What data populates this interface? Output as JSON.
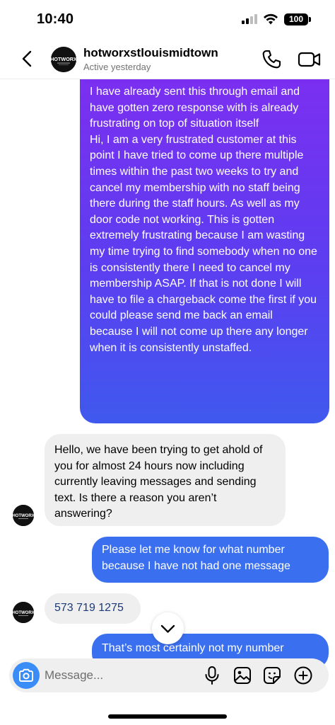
{
  "status_bar": {
    "time": "10:40",
    "battery": "100"
  },
  "header": {
    "name": "hotworxstlouismidtown",
    "status": "Active yesterday",
    "back_icon": "chevron-left-icon",
    "call_icon": "phone-icon",
    "video_icon": "video-camera-icon"
  },
  "avatar": {
    "logo_text": "HOTWORX"
  },
  "messages": [
    {
      "sender": "me",
      "text_1": "I have already sent this through email and have gotten zero response with is already frustrating on top of situation itself",
      "text_2": "Hi, I am a very frustrated customer at this point I have tried to come up there multiple times within the past two weeks to try and cancel my membership with no staff being there during the staff hours. As well as my door code not working. This is gotten extremely frustrating because I am wasting my time trying to find somebody when no one is consistently there I need to cancel my membership ASAP. If that is not done I will have to file a chargeback come the first if you could please send me back an email because I will not come up there any longer when it is consistently unstaffed."
    },
    {
      "sender": "them",
      "text": "Hello, we have been trying to get ahold of you for almost 24 hours now including currently leaving messages and sending text.  Is there a reason you aren’t answering?"
    },
    {
      "sender": "me",
      "text": "Please let me know for what number because I have not had one message"
    },
    {
      "sender": "them",
      "text": "573 719 1275"
    },
    {
      "sender": "me",
      "text": "That’s most certainly not my number"
    }
  ],
  "composer": {
    "placeholder": "Message...",
    "camera_icon": "camera-icon",
    "mic_icon": "microphone-icon",
    "gallery_icon": "image-icon",
    "sticker_icon": "sticker-icon",
    "plus_icon": "plus-circle-icon"
  },
  "colors": {
    "outgoing_gradient_top": "#7b2ff0",
    "outgoing_gradient_bottom": "#3f59ee",
    "outgoing_blue": "#3a6fef",
    "incoming_gray": "#efefef",
    "camera_blue": "#3a8cf6"
  }
}
